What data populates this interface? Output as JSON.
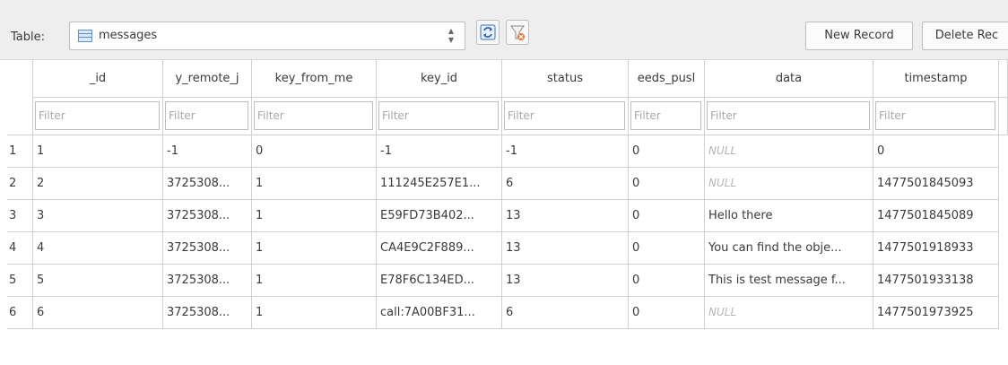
{
  "toolbar": {
    "table_label": "Table:",
    "table_name": "messages",
    "table_icon": "table-icon",
    "refresh_icon": "refresh-icon",
    "clear_filter_icon": "clear-filter-icon",
    "new_record_label": "New Record",
    "delete_record_label": "Delete Rec"
  },
  "columns": [
    "_id",
    "y_remote_j",
    "key_from_me",
    "key_id",
    "status",
    "eeds_pusl",
    "data",
    "timestamp"
  ],
  "filter_placeholder": "Filter",
  "rows": [
    {
      "num": "1",
      "cells": [
        "1",
        "-1",
        "0",
        "-1",
        "-1",
        "0",
        "NULL",
        "0"
      ]
    },
    {
      "num": "2",
      "cells": [
        "2",
        "3725308...",
        "1",
        "111245E257E1...",
        "6",
        "0",
        "NULL",
        "1477501845093"
      ]
    },
    {
      "num": "3",
      "cells": [
        "3",
        "3725308...",
        "1",
        "E59FD73B402...",
        "13",
        "0",
        "Hello there",
        "1477501845089"
      ]
    },
    {
      "num": "4",
      "cells": [
        "4",
        "3725308...",
        "1",
        "CA4E9C2F889...",
        "13",
        "0",
        "You can find the obje...",
        "1477501918933"
      ]
    },
    {
      "num": "5",
      "cells": [
        "5",
        "3725308...",
        "1",
        "E78F6C134ED...",
        "13",
        "0",
        "This is test message f...",
        "1477501933138"
      ]
    },
    {
      "num": "6",
      "cells": [
        "6",
        "3725308...",
        "1",
        "call:7A00BF31...",
        "6",
        "0",
        "NULL",
        "1477501973925"
      ]
    }
  ]
}
